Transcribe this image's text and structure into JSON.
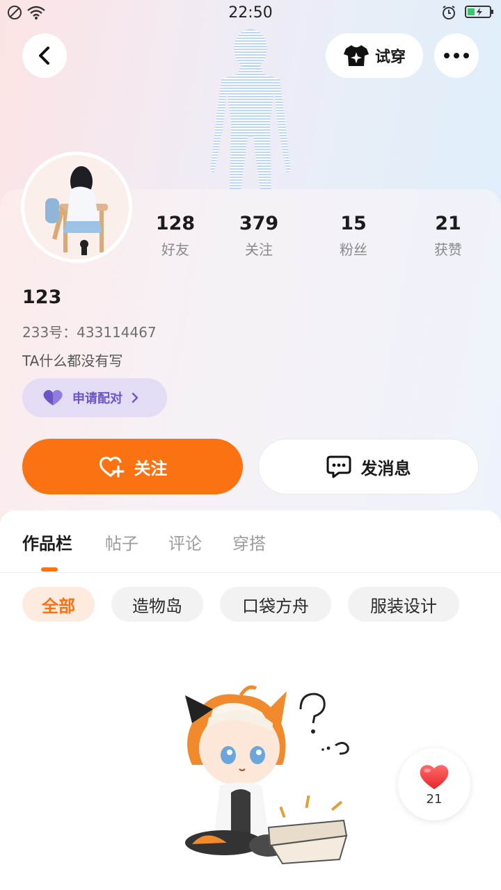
{
  "status_bar": {
    "time": "22:50"
  },
  "header": {
    "try_on_label": "试穿"
  },
  "profile": {
    "stats": [
      {
        "value": "128",
        "label": "好友"
      },
      {
        "value": "379",
        "label": "关注"
      },
      {
        "value": "15",
        "label": "粉丝"
      },
      {
        "value": "21",
        "label": "获赞"
      }
    ],
    "name": "123",
    "uid": "233号：433114467",
    "bio": "TA什么都没有写",
    "pair_label": "申请配对"
  },
  "actions": {
    "follow_label": "关注",
    "message_label": "发消息"
  },
  "tabs": [
    {
      "label": "作品栏"
    },
    {
      "label": "帖子"
    },
    {
      "label": "评论"
    },
    {
      "label": "穿搭"
    }
  ],
  "chips": [
    {
      "label": "全部"
    },
    {
      "label": "造物岛"
    },
    {
      "label": "口袋方舟"
    },
    {
      "label": "服装设计"
    }
  ],
  "like_fab": {
    "count": "21"
  },
  "colors": {
    "accent": "#fb7212",
    "pair_purple": "#6a56c8"
  }
}
